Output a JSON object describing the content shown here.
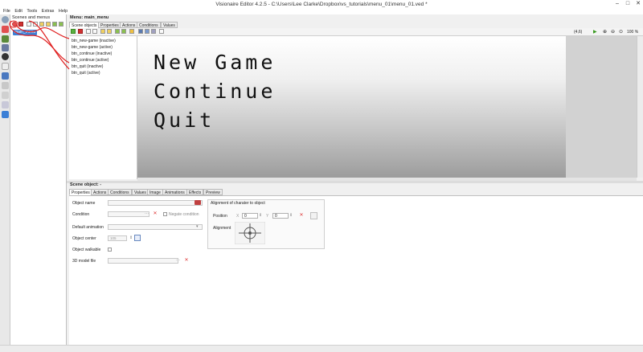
{
  "window": {
    "title": "Visionaire Editor 4.2.5 - C:\\Users\\Lee Clarke\\Dropbox\\vs_tutorials\\menu_01\\menu_01.ved *",
    "controls": [
      "–",
      "□",
      "✕"
    ]
  },
  "menubar": [
    "File",
    "Edit",
    "Tools",
    "Extras",
    "Help"
  ],
  "scenes_panel": {
    "header": "Scenes and menus",
    "selected_item": "main_menu"
  },
  "menu_panel": {
    "title": "Menu: main_menu",
    "tabs": [
      "Scene objects",
      "Properties",
      "Actions",
      "Conditions",
      "Values"
    ],
    "coords": "(4,6)",
    "zoom": "100 %",
    "objects": [
      "btn_new-game (inactive)",
      "btn_new-game (active)",
      "btn_continue (inactive)",
      "btn_continue (active)",
      "btn_quit (inactive)",
      "btn_quit (active)"
    ],
    "canvas_text": [
      "New Game",
      "Continue",
      "Quit"
    ]
  },
  "scene_object": {
    "title": "Scene object: -",
    "tabs": [
      "Properties",
      "Actions",
      "Conditions",
      "Values",
      "Image",
      "Animations",
      "Effects",
      "Preview"
    ],
    "fields": {
      "object_name": "Object name",
      "condition": "Condition",
      "negate_condition": "Negate condition",
      "default_animation": "Default animation",
      "object_center": "Object center",
      "object_center_value": "105",
      "object_walkable": "Object walkable",
      "model_file": "3D model file"
    },
    "alignment": {
      "header": "Alignment of charater to object",
      "position_label": "Position",
      "x_label": "X",
      "x_value": "0",
      "y_label": "Y",
      "y_value": "0",
      "alignment_label": "Alignment"
    }
  },
  "colors": {
    "selection": "#3b7fd6",
    "annotation": "#e02020"
  }
}
